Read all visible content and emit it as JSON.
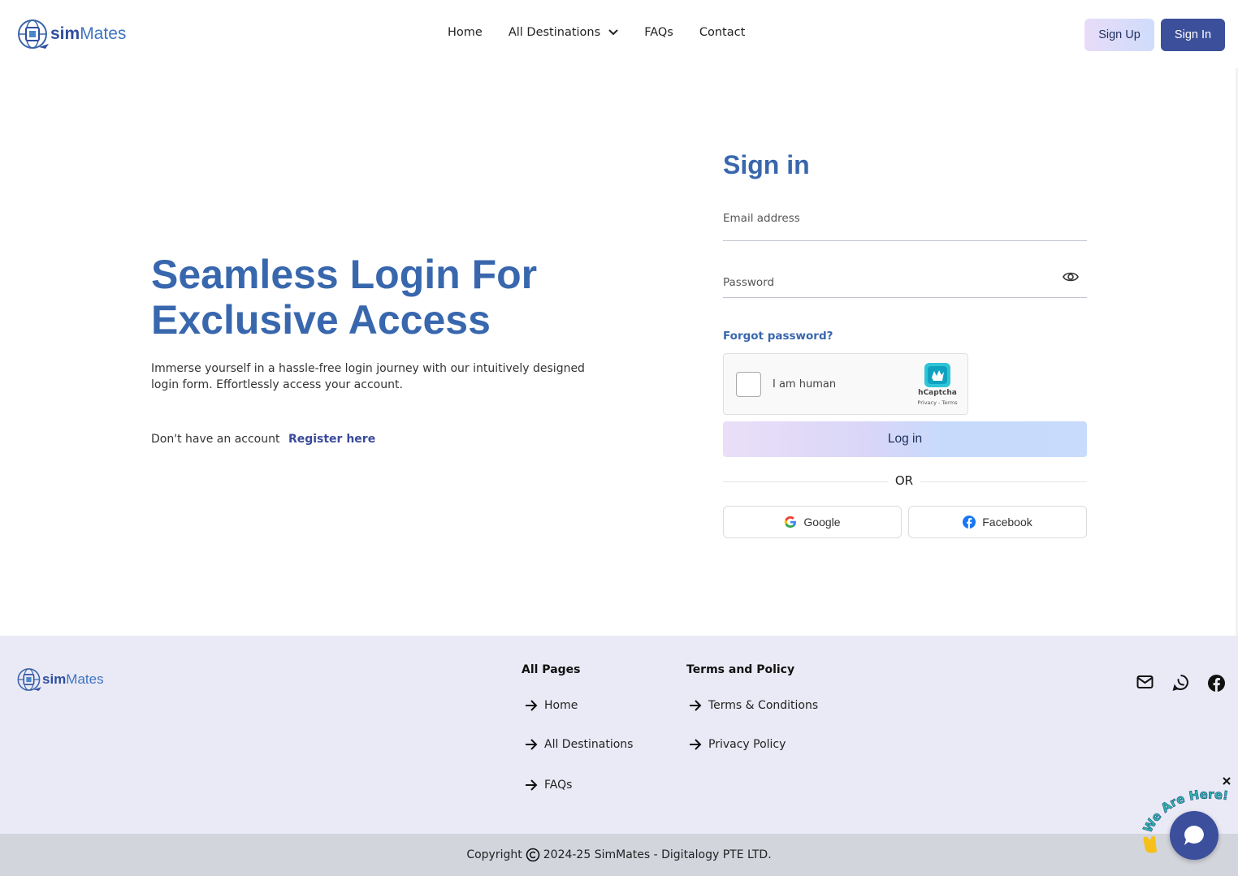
{
  "brand": {
    "name_bold": "sim",
    "name_light": "Mates"
  },
  "nav": {
    "items": [
      {
        "label": "Home"
      },
      {
        "label": "All Destinations"
      },
      {
        "label": "FAQs"
      },
      {
        "label": "Contact"
      }
    ],
    "signup_label": "Sign Up",
    "signin_label": "Sign In"
  },
  "hero": {
    "title_line1": "Seamless Login For",
    "title_line2": "Exclusive Access",
    "description": "Immerse yourself in a hassle-free login journey with our intuitively designed login form. Effortlessly access your account.",
    "no_account_text": "Don't have an account",
    "register_link": "Register here"
  },
  "form": {
    "title": "Sign in",
    "email_placeholder": "Email address",
    "password_placeholder": "Password",
    "forgot_label": "Forgot password?",
    "captcha": {
      "label": "I am human",
      "brand": "hCaptcha",
      "terms": "Privacy - Terms"
    },
    "login_label": "Log in",
    "or_label": "OR",
    "google_label": "Google",
    "facebook_label": "Facebook"
  },
  "footer": {
    "col1_title": "All Pages",
    "col1_links": [
      "Home",
      "All Destinations",
      "FAQs"
    ],
    "col2_title": "Terms and Policy",
    "col2_links": [
      "Terms & Conditions",
      "Privacy Policy"
    ],
    "copyright_prefix": "Copyright",
    "copyright_text": "2024-25 SimMates - Digitalogy PTE LTD."
  },
  "chat": {
    "banner_text": "We Are Here!"
  },
  "colors": {
    "primary_blue": "#3867ad",
    "button_dark": "#3b4f9a",
    "footer_bg": "#eaeaf6",
    "copyright_bg": "#d3d5dd"
  }
}
